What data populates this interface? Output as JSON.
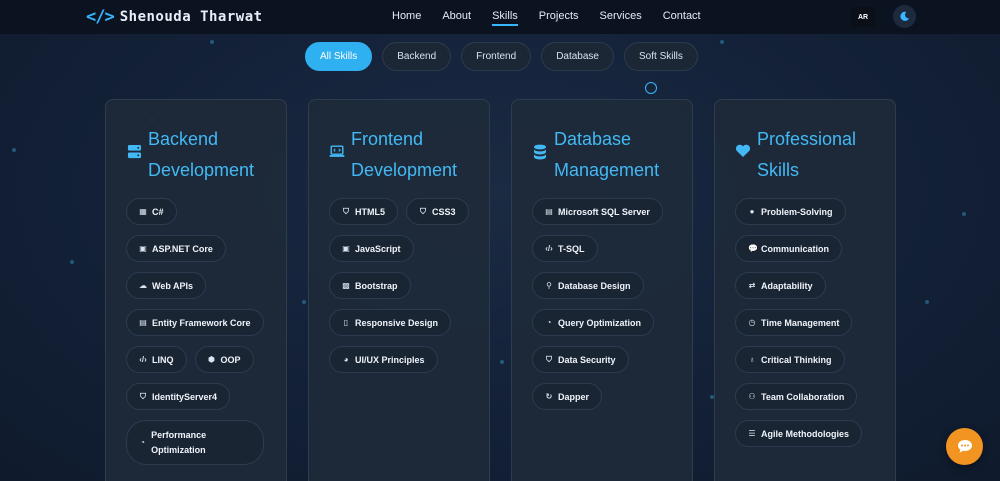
{
  "brand": {
    "icon": "</>",
    "name": "Shenouda Tharwat"
  },
  "nav": {
    "links": [
      {
        "label": "Home"
      },
      {
        "label": "About"
      },
      {
        "label": "Skills",
        "active": true
      },
      {
        "label": "Projects"
      },
      {
        "label": "Services"
      },
      {
        "label": "Contact"
      }
    ],
    "lang_label": "AR",
    "theme_icon": "moon-icon"
  },
  "filters": [
    "All Skills",
    "Backend",
    "Frontend",
    "Database",
    "Soft Skills"
  ],
  "colors": {
    "accent": "#38b6ff",
    "chat": "#f29422",
    "nav_bg": "#0c1320",
    "card_bg": "#1e2a3a"
  },
  "cards": [
    {
      "title_line1": "Backend",
      "title_line2": "Development",
      "icon": "server-icon",
      "skills": [
        {
          "label": "C#",
          "icon": "code-square-icon"
        },
        {
          "label": "ASP.NET Core",
          "icon": "window-icon"
        },
        {
          "label": "Web APIs",
          "icon": "cloud-icon"
        },
        {
          "label": "Entity Framework Core",
          "icon": "database-icon"
        },
        {
          "label": "LINQ",
          "icon": "code-icon"
        },
        {
          "label": "OOP",
          "icon": "cubes-icon"
        },
        {
          "label": "IdentityServer4",
          "icon": "shield-icon"
        },
        {
          "label": "Performance Optimization",
          "icon": "gauge-icon"
        }
      ]
    },
    {
      "title_line1": "Frontend",
      "title_line2": "Development",
      "icon": "laptop-code-icon",
      "skills": [
        {
          "label": "HTML5",
          "icon": "html5-icon"
        },
        {
          "label": "CSS3",
          "icon": "css3-icon"
        },
        {
          "label": "JavaScript",
          "icon": "js-icon"
        },
        {
          "label": "Bootstrap",
          "icon": "bootstrap-icon"
        },
        {
          "label": "Responsive Design",
          "icon": "mobile-icon"
        },
        {
          "label": "UI/UX Principles",
          "icon": "palette-icon"
        }
      ]
    },
    {
      "title_line1": "Database",
      "title_line2": "Management",
      "icon": "database-icon",
      "skills": [
        {
          "label": "Microsoft SQL Server",
          "icon": "database-icon"
        },
        {
          "label": "T-SQL",
          "icon": "code-icon"
        },
        {
          "label": "Database Design",
          "icon": "diagram-icon"
        },
        {
          "label": "Query Optimization",
          "icon": "gauge-icon"
        },
        {
          "label": "Data Security",
          "icon": "shield-icon"
        },
        {
          "label": "Dapper",
          "icon": "sync-icon"
        }
      ]
    },
    {
      "title_line1": "Professional",
      "title_line2": "Skills",
      "icon": "heart-icon",
      "skills": [
        {
          "label": "Problem-Solving",
          "icon": "brain-icon"
        },
        {
          "label": "Communication",
          "icon": "comments-icon"
        },
        {
          "label": "Adaptability",
          "icon": "exchange-icon"
        },
        {
          "label": "Time Management",
          "icon": "clock-icon"
        },
        {
          "label": "Critical Thinking",
          "icon": "lightbulb-icon"
        },
        {
          "label": "Team Collaboration",
          "icon": "users-icon"
        },
        {
          "label": "Agile Methodologies",
          "icon": "tasks-icon"
        }
      ]
    }
  ]
}
